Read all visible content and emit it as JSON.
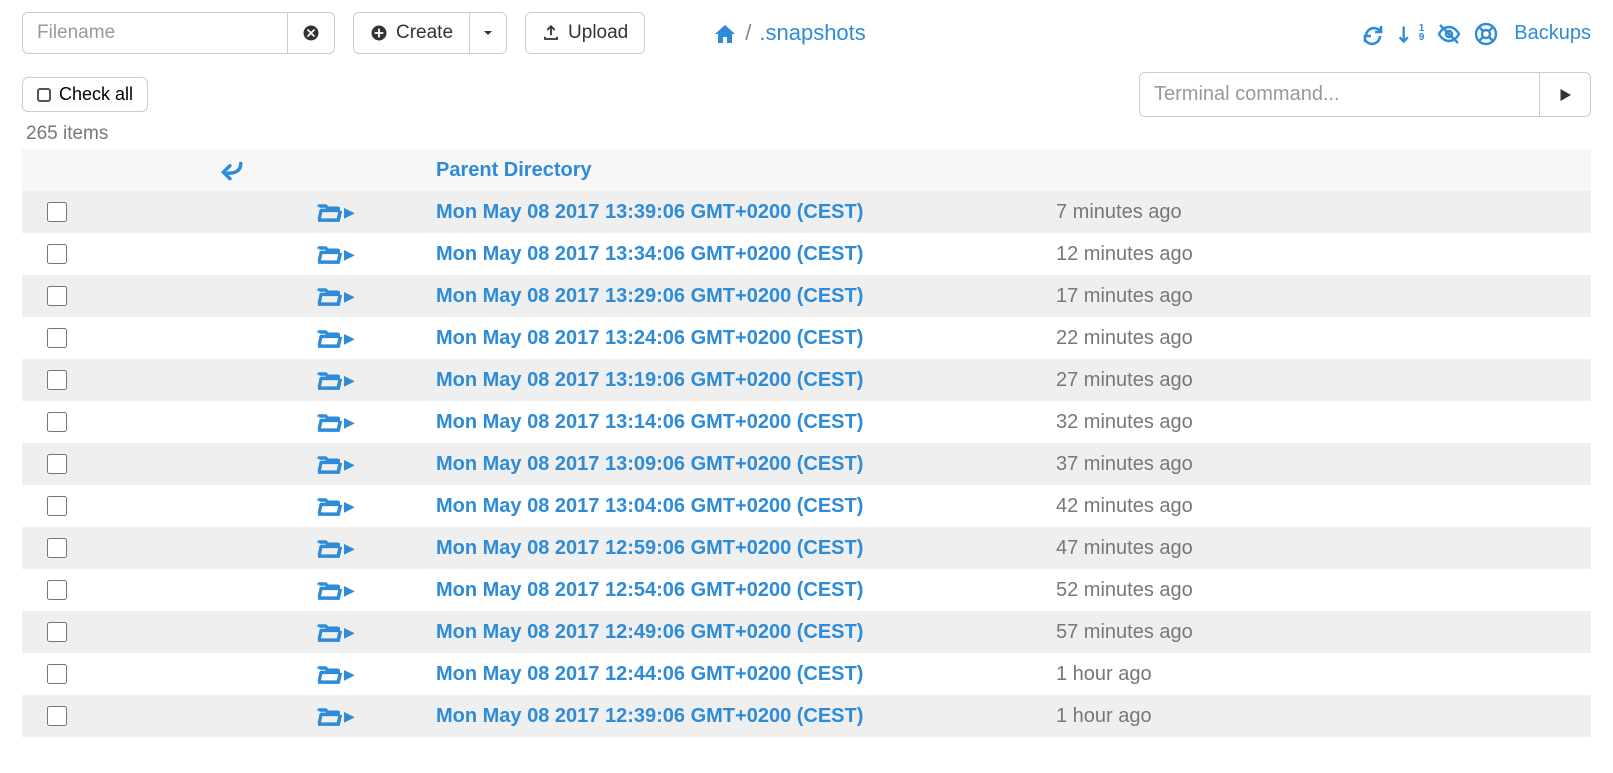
{
  "toolbar": {
    "filename_placeholder": "Filename",
    "create_label": "Create",
    "upload_label": "Upload"
  },
  "breadcrumb": {
    "current": ".snapshots"
  },
  "right": {
    "backups_label": "Backups"
  },
  "checkall_label": "Check all",
  "terminal_placeholder": "Terminal command...",
  "item_count_label": "265 items",
  "parent_label": "Parent Directory",
  "rows": [
    {
      "name": "Mon May 08 2017 13:39:06 GMT+0200 (CEST)",
      "age": "7 minutes ago"
    },
    {
      "name": "Mon May 08 2017 13:34:06 GMT+0200 (CEST)",
      "age": "12 minutes ago"
    },
    {
      "name": "Mon May 08 2017 13:29:06 GMT+0200 (CEST)",
      "age": "17 minutes ago"
    },
    {
      "name": "Mon May 08 2017 13:24:06 GMT+0200 (CEST)",
      "age": "22 minutes ago"
    },
    {
      "name": "Mon May 08 2017 13:19:06 GMT+0200 (CEST)",
      "age": "27 minutes ago"
    },
    {
      "name": "Mon May 08 2017 13:14:06 GMT+0200 (CEST)",
      "age": "32 minutes ago"
    },
    {
      "name": "Mon May 08 2017 13:09:06 GMT+0200 (CEST)",
      "age": "37 minutes ago"
    },
    {
      "name": "Mon May 08 2017 13:04:06 GMT+0200 (CEST)",
      "age": "42 minutes ago"
    },
    {
      "name": "Mon May 08 2017 12:59:06 GMT+0200 (CEST)",
      "age": "47 minutes ago"
    },
    {
      "name": "Mon May 08 2017 12:54:06 GMT+0200 (CEST)",
      "age": "52 minutes ago"
    },
    {
      "name": "Mon May 08 2017 12:49:06 GMT+0200 (CEST)",
      "age": "57 minutes ago"
    },
    {
      "name": "Mon May 08 2017 12:44:06 GMT+0200 (CEST)",
      "age": "1 hour ago"
    },
    {
      "name": "Mon May 08 2017 12:39:06 GMT+0200 (CEST)",
      "age": "1 hour ago"
    }
  ]
}
